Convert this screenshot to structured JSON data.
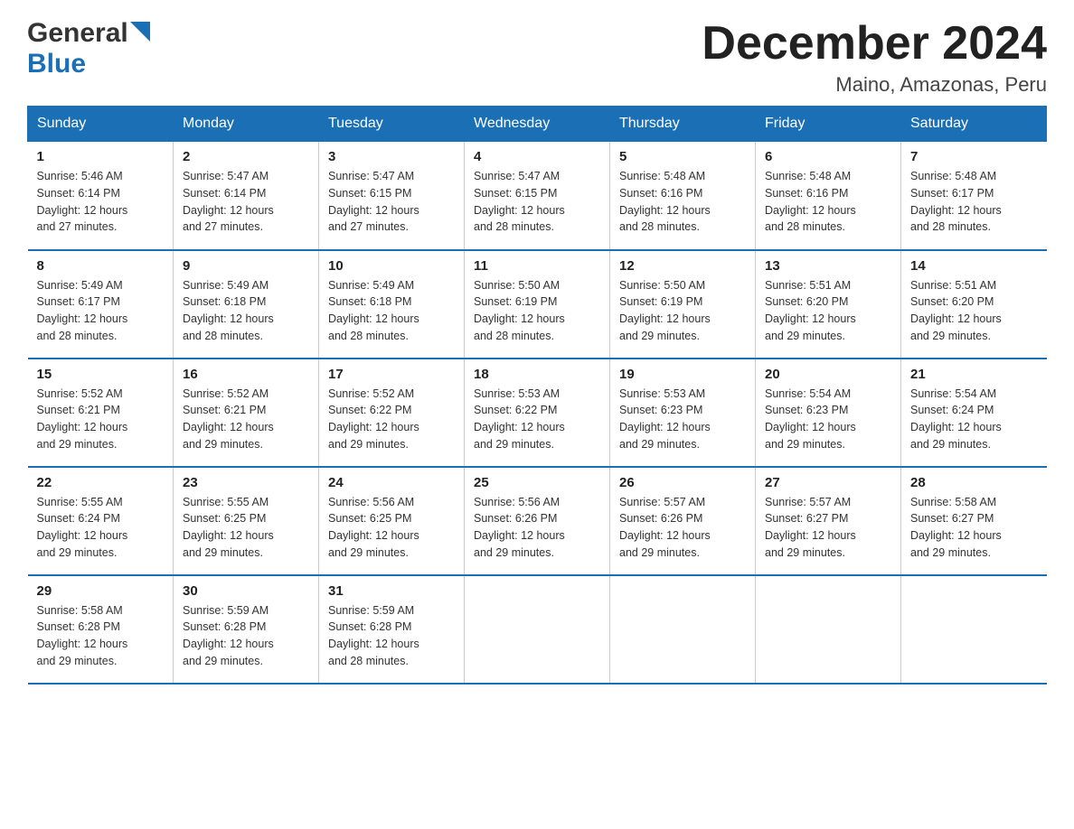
{
  "logo": {
    "general": "General",
    "blue": "Blue"
  },
  "header": {
    "month": "December 2024",
    "location": "Maino, Amazonas, Peru"
  },
  "weekdays": [
    "Sunday",
    "Monday",
    "Tuesday",
    "Wednesday",
    "Thursday",
    "Friday",
    "Saturday"
  ],
  "weeks": [
    [
      {
        "day": "1",
        "sunrise": "5:46 AM",
        "sunset": "6:14 PM",
        "daylight": "12 hours and 27 minutes."
      },
      {
        "day": "2",
        "sunrise": "5:47 AM",
        "sunset": "6:14 PM",
        "daylight": "12 hours and 27 minutes."
      },
      {
        "day": "3",
        "sunrise": "5:47 AM",
        "sunset": "6:15 PM",
        "daylight": "12 hours and 27 minutes."
      },
      {
        "day": "4",
        "sunrise": "5:47 AM",
        "sunset": "6:15 PM",
        "daylight": "12 hours and 28 minutes."
      },
      {
        "day": "5",
        "sunrise": "5:48 AM",
        "sunset": "6:16 PM",
        "daylight": "12 hours and 28 minutes."
      },
      {
        "day": "6",
        "sunrise": "5:48 AM",
        "sunset": "6:16 PM",
        "daylight": "12 hours and 28 minutes."
      },
      {
        "day": "7",
        "sunrise": "5:48 AM",
        "sunset": "6:17 PM",
        "daylight": "12 hours and 28 minutes."
      }
    ],
    [
      {
        "day": "8",
        "sunrise": "5:49 AM",
        "sunset": "6:17 PM",
        "daylight": "12 hours and 28 minutes."
      },
      {
        "day": "9",
        "sunrise": "5:49 AM",
        "sunset": "6:18 PM",
        "daylight": "12 hours and 28 minutes."
      },
      {
        "day": "10",
        "sunrise": "5:49 AM",
        "sunset": "6:18 PM",
        "daylight": "12 hours and 28 minutes."
      },
      {
        "day": "11",
        "sunrise": "5:50 AM",
        "sunset": "6:19 PM",
        "daylight": "12 hours and 28 minutes."
      },
      {
        "day": "12",
        "sunrise": "5:50 AM",
        "sunset": "6:19 PM",
        "daylight": "12 hours and 29 minutes."
      },
      {
        "day": "13",
        "sunrise": "5:51 AM",
        "sunset": "6:20 PM",
        "daylight": "12 hours and 29 minutes."
      },
      {
        "day": "14",
        "sunrise": "5:51 AM",
        "sunset": "6:20 PM",
        "daylight": "12 hours and 29 minutes."
      }
    ],
    [
      {
        "day": "15",
        "sunrise": "5:52 AM",
        "sunset": "6:21 PM",
        "daylight": "12 hours and 29 minutes."
      },
      {
        "day": "16",
        "sunrise": "5:52 AM",
        "sunset": "6:21 PM",
        "daylight": "12 hours and 29 minutes."
      },
      {
        "day": "17",
        "sunrise": "5:52 AM",
        "sunset": "6:22 PM",
        "daylight": "12 hours and 29 minutes."
      },
      {
        "day": "18",
        "sunrise": "5:53 AM",
        "sunset": "6:22 PM",
        "daylight": "12 hours and 29 minutes."
      },
      {
        "day": "19",
        "sunrise": "5:53 AM",
        "sunset": "6:23 PM",
        "daylight": "12 hours and 29 minutes."
      },
      {
        "day": "20",
        "sunrise": "5:54 AM",
        "sunset": "6:23 PM",
        "daylight": "12 hours and 29 minutes."
      },
      {
        "day": "21",
        "sunrise": "5:54 AM",
        "sunset": "6:24 PM",
        "daylight": "12 hours and 29 minutes."
      }
    ],
    [
      {
        "day": "22",
        "sunrise": "5:55 AM",
        "sunset": "6:24 PM",
        "daylight": "12 hours and 29 minutes."
      },
      {
        "day": "23",
        "sunrise": "5:55 AM",
        "sunset": "6:25 PM",
        "daylight": "12 hours and 29 minutes."
      },
      {
        "day": "24",
        "sunrise": "5:56 AM",
        "sunset": "6:25 PM",
        "daylight": "12 hours and 29 minutes."
      },
      {
        "day": "25",
        "sunrise": "5:56 AM",
        "sunset": "6:26 PM",
        "daylight": "12 hours and 29 minutes."
      },
      {
        "day": "26",
        "sunrise": "5:57 AM",
        "sunset": "6:26 PM",
        "daylight": "12 hours and 29 minutes."
      },
      {
        "day": "27",
        "sunrise": "5:57 AM",
        "sunset": "6:27 PM",
        "daylight": "12 hours and 29 minutes."
      },
      {
        "day": "28",
        "sunrise": "5:58 AM",
        "sunset": "6:27 PM",
        "daylight": "12 hours and 29 minutes."
      }
    ],
    [
      {
        "day": "29",
        "sunrise": "5:58 AM",
        "sunset": "6:28 PM",
        "daylight": "12 hours and 29 minutes."
      },
      {
        "day": "30",
        "sunrise": "5:59 AM",
        "sunset": "6:28 PM",
        "daylight": "12 hours and 29 minutes."
      },
      {
        "day": "31",
        "sunrise": "5:59 AM",
        "sunset": "6:28 PM",
        "daylight": "12 hours and 28 minutes."
      },
      null,
      null,
      null,
      null
    ]
  ],
  "labels": {
    "sunrise": "Sunrise:",
    "sunset": "Sunset:",
    "daylight": "Daylight:"
  }
}
